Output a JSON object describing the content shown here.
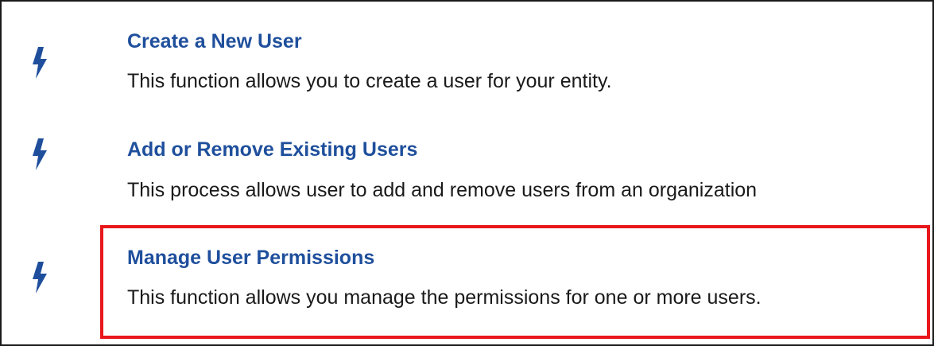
{
  "items": [
    {
      "icon": "lightning-bolt-icon",
      "title": "Create a New User",
      "description": "This function allows you to create a user for your entity."
    },
    {
      "icon": "lightning-bolt-icon",
      "title": "Add or Remove Existing Users",
      "description": "This process allows user to add and remove users from an organization"
    },
    {
      "icon": "lightning-bolt-icon",
      "title": "Manage User Permissions",
      "description": "This function allows you manage the permissions for one or more users.",
      "highlighted": true
    }
  ],
  "colors": {
    "link": "#1f4f9c",
    "text": "#1a1a1a",
    "highlight": "#e8171c",
    "icon": "#1f4f9c"
  }
}
